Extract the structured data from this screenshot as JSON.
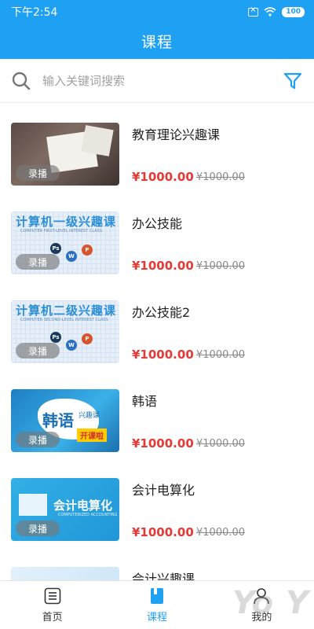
{
  "status_bar": {
    "time": "下午2:54",
    "battery": "100"
  },
  "header": {
    "title": "课程"
  },
  "search": {
    "placeholder": "输入关键词搜索"
  },
  "courses": [
    {
      "title": "教育理论兴趣课",
      "badge": "录播",
      "price": "¥1000.00",
      "original_price": "¥1000.00"
    },
    {
      "title": "办公技能",
      "badge": "录播",
      "price": "¥1000.00",
      "original_price": "¥1000.00",
      "thumb_text": "计算机一级兴趣课",
      "thumb_sub": "COMPUTER FIRST-LEVEL INTEREST CLASS"
    },
    {
      "title": "办公技能2",
      "badge": "录播",
      "price": "¥1000.00",
      "original_price": "¥1000.00",
      "thumb_text": "计算机二级兴趣课",
      "thumb_sub": "COMPUTER SECOND-LEVEL INTEREST CLASS"
    },
    {
      "title": "韩语",
      "badge": "录播",
      "price": "¥1000.00",
      "original_price": "¥1000.00",
      "thumb_text": "韩语",
      "thumb_sub": "兴趣课",
      "thumb_tag": "开课啦"
    },
    {
      "title": "会计电算化",
      "badge": "录播",
      "price": "¥1000.00",
      "original_price": "¥1000.00",
      "thumb_text": "会计电算化",
      "thumb_sub": "COMPUTERIZED ACCOUNTING"
    },
    {
      "title": "会计兴趣课"
    }
  ],
  "app_icons": [
    "Ps",
    "W",
    "P"
  ],
  "nav": [
    {
      "label": "首页",
      "icon": "home-list-icon"
    },
    {
      "label": "课程",
      "icon": "course-book-icon",
      "active": true
    },
    {
      "label": "我的",
      "icon": "profile-icon"
    }
  ],
  "watermark": "Yo Y",
  "colors": {
    "primary": "#1fa1f3",
    "price": "#e53935"
  }
}
